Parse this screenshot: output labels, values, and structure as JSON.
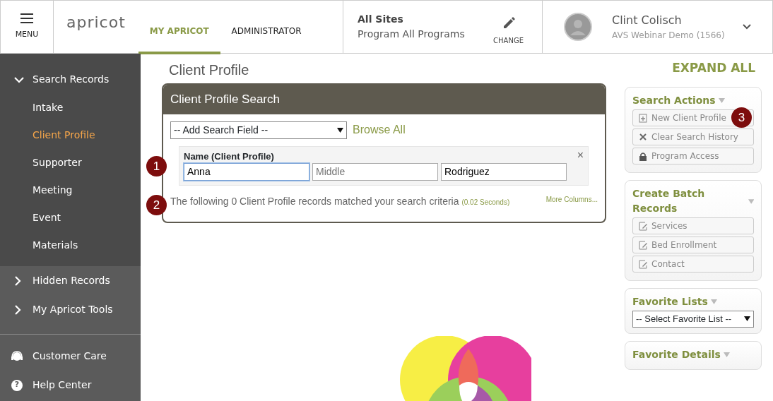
{
  "header": {
    "menu_label": "MENU",
    "logo": "apricot",
    "tabs": [
      {
        "label": "MY APRICOT",
        "selected": true
      },
      {
        "label": "ADMINISTRATOR",
        "selected": false
      }
    ],
    "site": {
      "title": "All Sites",
      "program": "Program All Programs",
      "change_label": "CHANGE"
    },
    "user": {
      "name": "Clint Colisch",
      "org": "AVS Webinar Demo (1566)"
    }
  },
  "sidebar": {
    "groups": [
      {
        "label": "Search Records",
        "expanded": true,
        "children": [
          {
            "label": "Intake",
            "selected": false
          },
          {
            "label": "Client Profile",
            "selected": true
          },
          {
            "label": "Supporter",
            "selected": false
          },
          {
            "label": "Meeting",
            "selected": false
          },
          {
            "label": "Event",
            "selected": false
          },
          {
            "label": "Materials",
            "selected": false
          }
        ]
      },
      {
        "label": "Hidden Records",
        "expanded": false
      },
      {
        "label": "My Apricot Tools",
        "expanded": false
      }
    ],
    "links": [
      {
        "kind": "headset",
        "label": "Customer Care"
      },
      {
        "kind": "help",
        "icon": "?",
        "label": "Help Center"
      }
    ]
  },
  "page": {
    "title": "Client Profile",
    "expand_all": "EXPAND ALL"
  },
  "search_panel": {
    "title": "Client Profile Search",
    "add_field": "-- Add Search Field --",
    "browse_all": "Browse All",
    "field_group": {
      "label": "Name (Client Profile)",
      "close": "×",
      "inputs": [
        {
          "value": "Anna",
          "focused": true
        },
        {
          "placeholder": "Middle",
          "focused": false
        },
        {
          "value": "Rodriguez",
          "focused": false
        }
      ]
    },
    "result": "The following 0 Client Profile records matched your search criteria",
    "timing": "(0.02 Seconds)",
    "more_columns": "More Columns..."
  },
  "callouts": [
    "1",
    "2",
    "3"
  ],
  "right_panels": [
    {
      "title": "Search Actions",
      "kind": "buttons",
      "buttons": [
        {
          "label": "New Client Profile"
        },
        {
          "label": "Clear Search History"
        },
        {
          "label": "Program Access"
        }
      ]
    },
    {
      "title": "Create Batch Records",
      "kind": "buttons",
      "buttons": [
        {
          "label": "Services"
        },
        {
          "label": "Bed Enrollment"
        },
        {
          "label": "Contact"
        }
      ]
    },
    {
      "title": "Favorite Lists",
      "kind": "select",
      "select": "-- Select Favorite List --"
    },
    {
      "title": "Favorite Details",
      "kind": "empty"
    }
  ]
}
